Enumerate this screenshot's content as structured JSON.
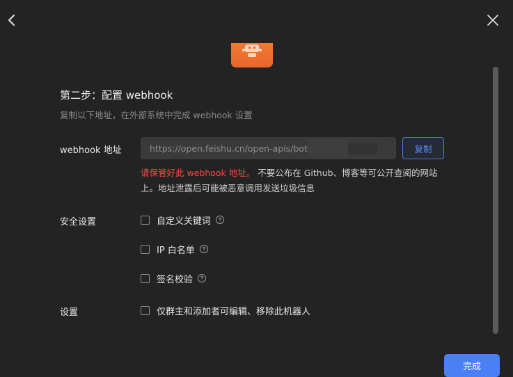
{
  "header": {
    "back_icon": "chevron-left-icon",
    "close_icon": "close-icon"
  },
  "bot": {
    "logo_icon": "robot-icon",
    "logo_color": "#ee6f2e"
  },
  "step": {
    "title": "第二步：配置 webhook",
    "description": "复制以下地址，在外部系统中完成 webhook 设置"
  },
  "webhook": {
    "label": "webhook 地址",
    "url_value": "https://open.feishu.cn/open-apis/bot/        k/d...",
    "copy_label": "复制",
    "warning_emphasis": "请保管好此 webhook 地址。",
    "warning_text": " 不要公布在 Github、博客等可公开查阅的网站上。地址泄露后可能被恶意调用发送垃圾信息"
  },
  "security": {
    "label": "安全设置",
    "options": [
      {
        "label": "自定义关键词",
        "checked": false,
        "help_icon": "help-circle-icon"
      },
      {
        "label": "IP 白名单",
        "checked": false,
        "help_icon": "help-circle-icon"
      },
      {
        "label": "签名校验",
        "checked": false,
        "help_icon": "help-circle-icon"
      }
    ]
  },
  "settings": {
    "label": "设置",
    "option_label": "仅群主和添加者可编辑、移除此机器人",
    "checked": false
  },
  "footer": {
    "done_label": "完成"
  },
  "colors": {
    "background": "#232323",
    "accent": "#4a7ff5",
    "warning": "#f54a45",
    "muted_text": "#8a8a8a"
  }
}
